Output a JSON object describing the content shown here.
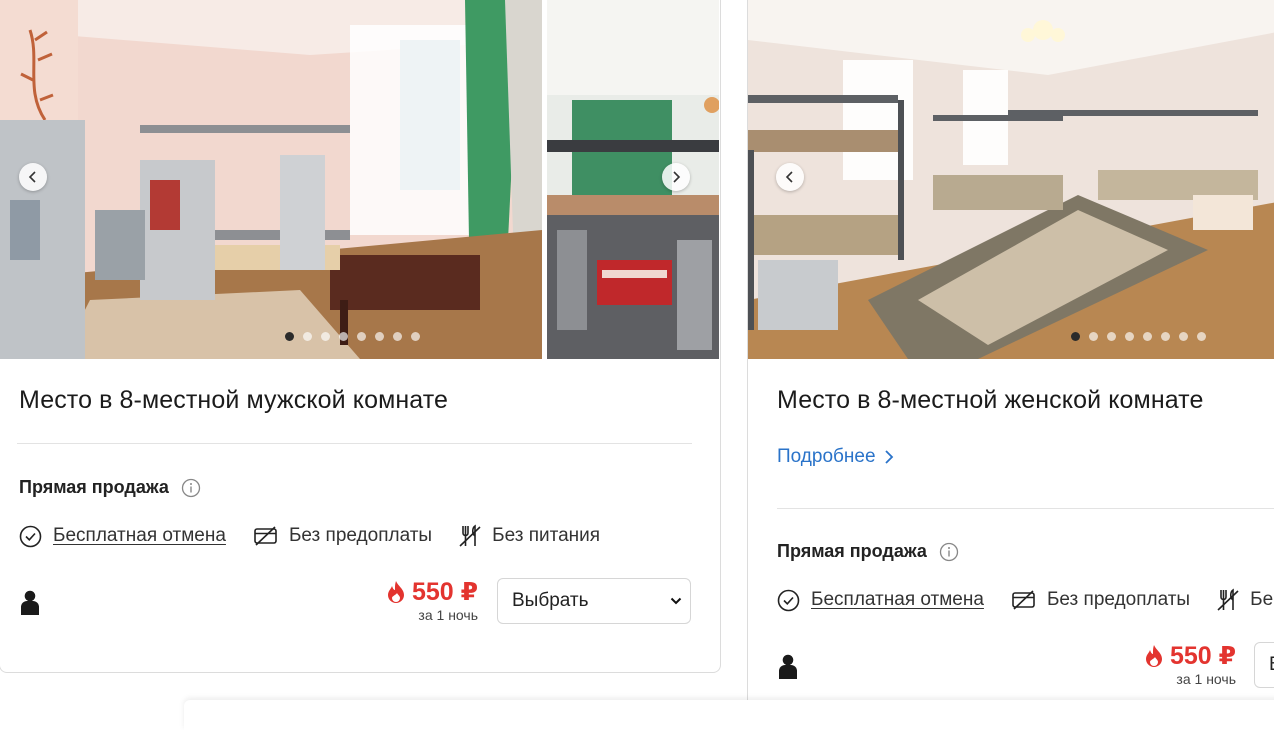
{
  "cards": [
    {
      "title": "Место в 8-местной мужской комнате",
      "direct_sale": "Прямая продажа",
      "features": {
        "cancel": "Бесплатная отмена",
        "prepay": "Без предоплаты",
        "meal": "Без питания"
      },
      "price": "550 ₽",
      "per_night": "за 1 ночь",
      "select_value": "Выбрать",
      "photo_count": 8,
      "active_photo": 1
    },
    {
      "title": "Место в 8-местной женской комнате",
      "more_link": "Подробнее",
      "direct_sale": "Прямая продажа",
      "features": {
        "cancel": "Бесплатная отмена",
        "prepay": "Без предоплаты",
        "meal": "Бе"
      },
      "price": "550 ₽",
      "per_night": "за 1 ночь",
      "select_value": "В",
      "active_photo": 1
    }
  ],
  "colors": {
    "price": "#e3342f",
    "link": "#2a73c9",
    "divider": "#e3e3e3"
  },
  "icons": {
    "prev": "chevron-left-icon",
    "next": "chevron-right-icon",
    "info": "info-icon",
    "cancel": "check-circle-icon",
    "prepay": "no-card-icon",
    "meal": "fork-knife-icon",
    "person": "person-icon",
    "fire": "fire-icon",
    "select": "chevron-down-icon"
  }
}
